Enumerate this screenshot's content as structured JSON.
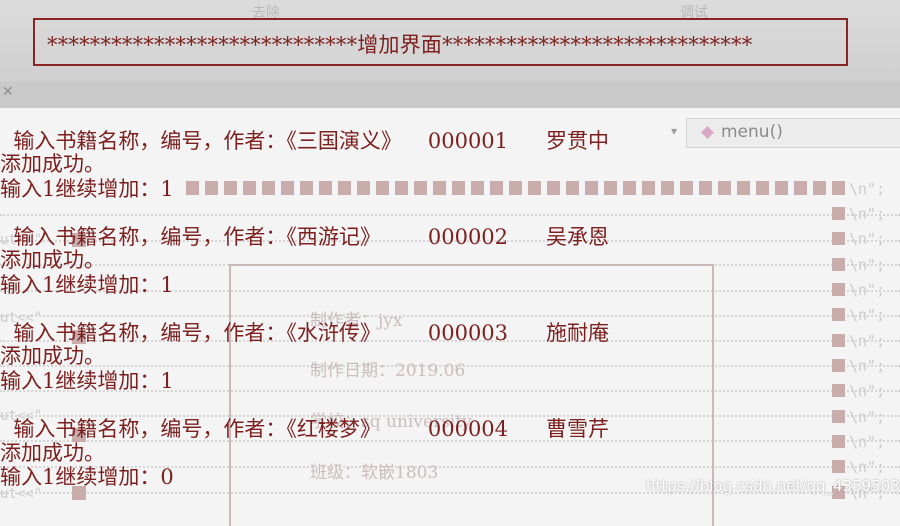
{
  "background": {
    "toolbar_items": [
      "去除",
      "调试"
    ],
    "menu_label": "menu()",
    "newline_token": "\\n\";",
    "code_fragment": "ut<<\"",
    "info_lines": [
      "制作者：jyx",
      "制作日期：2019.06",
      "学校：sq university",
      "班级：软嵌1803"
    ],
    "watermark": "https://blog.csdn.net/qq_43595030"
  },
  "console": {
    "title": "*****************************增加界面*****************************",
    "entries": [
      {
        "prompt": "输入书籍名称，编号，作者：",
        "name": "《三国演义》",
        "id": "000001",
        "author": "罗贯中",
        "success": "添加成功。",
        "continue": "输入1继续增加：1"
      },
      {
        "prompt": "输入书籍名称，编号，作者：",
        "name": "《西游记》",
        "id": "000002",
        "author": "吴承恩",
        "success": "添加成功。",
        "continue": "输入1继续增加：1"
      },
      {
        "prompt": "输入书籍名称，编号，作者：",
        "name": "《水浒传》",
        "id": "000003",
        "author": "施耐庵",
        "success": "添加成功。",
        "continue": "输入1继续增加：1"
      },
      {
        "prompt": "输入书籍名称，编号，作者：",
        "name": "《红楼梦》",
        "id": "000004",
        "author": "曹雪芹",
        "success": "添加成功。",
        "continue": "输入1继续增加：0"
      }
    ]
  },
  "colors": {
    "console_text": "#7c1f1f",
    "title_border": "#8b2424"
  }
}
